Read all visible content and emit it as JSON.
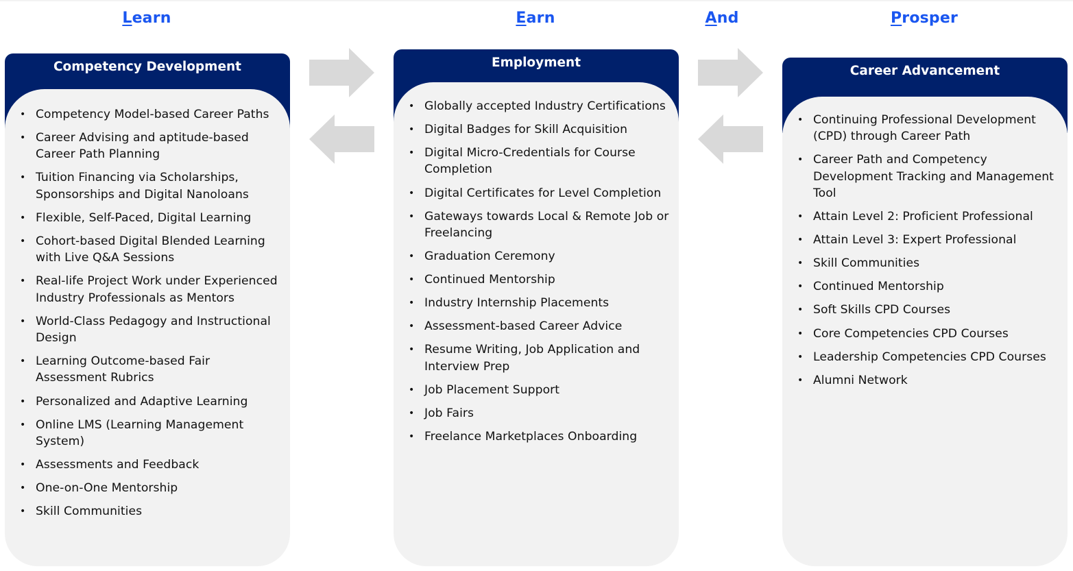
{
  "theme": {
    "heading_color": "#1a56f0",
    "header_bg": "#00206b",
    "card_body_bg": "#f2f2f2",
    "arrow_color": "#d9d9d9",
    "text_color": "#111111"
  },
  "headings": [
    {
      "first": "L",
      "rest": "earn"
    },
    {
      "first": "E",
      "rest": "arn"
    },
    {
      "first": "A",
      "rest": "nd"
    },
    {
      "first": "P",
      "rest": "rosper"
    }
  ],
  "arrows": [
    {
      "direction": "right",
      "icon": "arrow-right-icon"
    },
    {
      "direction": "left",
      "icon": "arrow-left-icon"
    },
    {
      "direction": "right",
      "icon": "arrow-right-icon"
    },
    {
      "direction": "left",
      "icon": "arrow-left-icon"
    }
  ],
  "cards": [
    {
      "title": "Competency Development",
      "bullet": "•",
      "items": [
        "Competency Model-based Career Paths",
        "Career Advising and aptitude-based Career Path Planning",
        "Tuition Financing via Scholarships, Sponsorships and Digital Nanoloans",
        "Flexible, Self-Paced, Digital Learning",
        "Cohort-based Digital Blended Learning with Live Q&A Sessions",
        "Real-life Project Work under Experienced Industry Professionals as Mentors",
        "World-Class Pedagogy and Instructional Design",
        "Learning Outcome-based Fair Assessment Rubrics",
        "Personalized and Adaptive Learning",
        "Online LMS (Learning Management System)",
        "Assessments and Feedback",
        "One-on-One Mentorship",
        "Skill Communities"
      ]
    },
    {
      "title": "Employment",
      "bullet": "•",
      "items": [
        "Globally accepted Industry Certifications",
        "Digital Badges for Skill Acquisition",
        "Digital Micro-Credentials for Course Completion",
        "Digital Certificates for Level Completion",
        "Gateways towards Local & Remote Job or Freelancing",
        "Graduation Ceremony",
        "Continued Mentorship",
        "Industry Internship Placements",
        "Assessment-based Career Advice",
        "Resume Writing, Job Application and Interview Prep",
        "Job Placement Support",
        "Job Fairs",
        "Freelance Marketplaces Onboarding"
      ]
    },
    {
      "title": "Career Advancement",
      "bullet": "•",
      "items": [
        "Continuing Professional Development (CPD) through Career Path",
        "Career Path and Competency Development Tracking and Management Tool",
        "Attain Level 2: Proficient Professional",
        "Attain Level 3: Expert Professional",
        "Skill Communities",
        "Continued Mentorship",
        "Soft Skills CPD Courses",
        "Core Competencies CPD Courses",
        "Leadership Competencies CPD Courses",
        "Alumni Network"
      ]
    }
  ]
}
